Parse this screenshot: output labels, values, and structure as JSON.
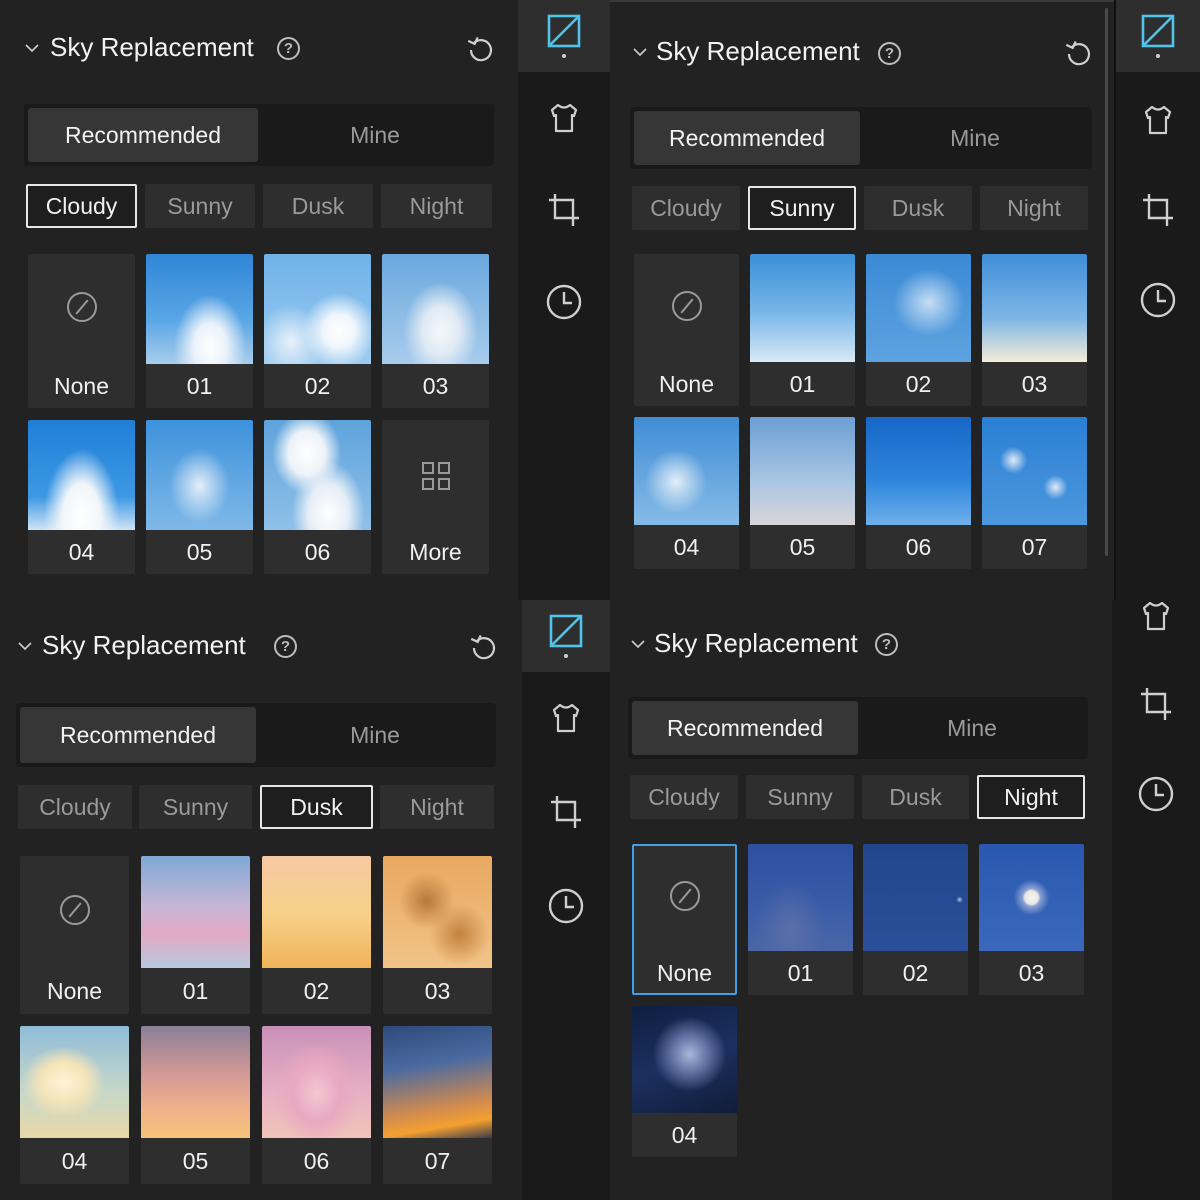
{
  "panels": [
    {
      "title": "Sky Replacement",
      "tabs": [
        "Recommended",
        "Mine"
      ],
      "active_tab": "Recommended",
      "categories": [
        "Cloudy",
        "Sunny",
        "Dusk",
        "Night"
      ],
      "active_category": "Cloudy",
      "tiles": [
        "None",
        "01",
        "02",
        "03",
        "04",
        "05",
        "06",
        "More"
      ]
    },
    {
      "title": "Sky Replacement",
      "tabs": [
        "Recommended",
        "Mine"
      ],
      "active_tab": "Recommended",
      "categories": [
        "Cloudy",
        "Sunny",
        "Dusk",
        "Night"
      ],
      "active_category": "Sunny",
      "tiles": [
        "None",
        "01",
        "02",
        "03",
        "04",
        "05",
        "06",
        "07"
      ]
    },
    {
      "title": "Sky Replacement",
      "tabs": [
        "Recommended",
        "Mine"
      ],
      "active_tab": "Recommended",
      "categories": [
        "Cloudy",
        "Sunny",
        "Dusk",
        "Night"
      ],
      "active_category": "Dusk",
      "tiles": [
        "None",
        "01",
        "02",
        "03",
        "04",
        "05",
        "06",
        "07"
      ]
    },
    {
      "title": "Sky Replacement",
      "tabs": [
        "Recommended",
        "Mine"
      ],
      "active_tab": "Recommended",
      "categories": [
        "Cloudy",
        "Sunny",
        "Dusk",
        "Night"
      ],
      "active_category": "Night",
      "selected_tile": "None",
      "tiles": [
        "None",
        "01",
        "02",
        "03",
        "04"
      ]
    }
  ],
  "toolbar_icons": [
    "adjust-icon",
    "shirt-icon",
    "crop-icon",
    "history-icon"
  ],
  "colors": {
    "accent": "#4fc3e8",
    "selection": "#3fa0e6",
    "panel_bg": "#222222",
    "toolbar_bg": "#1a1a1a"
  }
}
